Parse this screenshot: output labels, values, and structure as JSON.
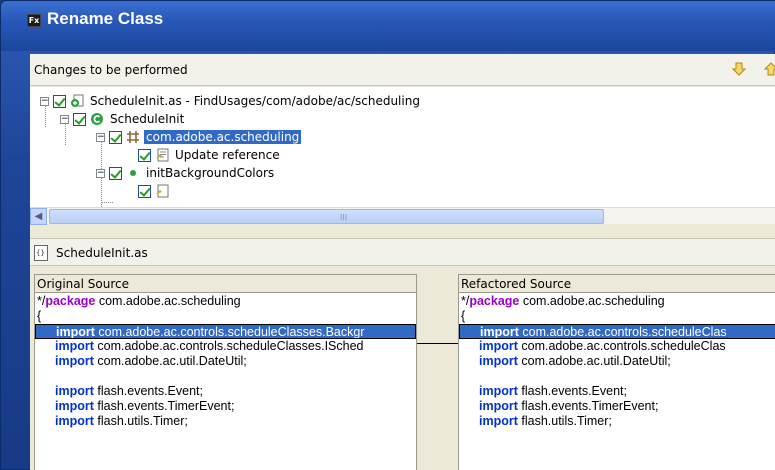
{
  "window": {
    "icon_text": "Fx",
    "title": "Rename Class"
  },
  "changes_panel": {
    "label": "Changes to be performed"
  },
  "tree": {
    "nodes": [
      {
        "label": "ScheduleInit.as - FindUsages/com/adobe/ac/scheduling"
      },
      {
        "label": "ScheduleInit"
      },
      {
        "label": "com.adobe.ac.scheduling"
      },
      {
        "label": "Update reference"
      },
      {
        "label": "initBackgroundColors"
      }
    ]
  },
  "scrollbar": {
    "grip": "III"
  },
  "file_panel": {
    "label": "ScheduleInit.as"
  },
  "original": {
    "title": "Original Source",
    "lines": [
      {
        "pre": "*/",
        "kw": "package",
        "rest": " com.adobe.ac.scheduling"
      },
      {
        "text": "{"
      },
      {
        "imp": "import",
        "rest": " com.adobe.ac.controls.scheduleClasses.Backgr"
      },
      {
        "imp": "import",
        "rest": " com.adobe.ac.controls.scheduleClasses.ISched"
      },
      {
        "imp": "import",
        "rest": " com.adobe.ac.util.DateUtil;"
      },
      {
        "text": ""
      },
      {
        "imp": "import",
        "rest": " flash.events.Event;"
      },
      {
        "imp": "import",
        "rest": " flash.events.TimerEvent;"
      },
      {
        "imp": "import",
        "rest": " flash.utils.Timer;"
      }
    ]
  },
  "refactored": {
    "title": "Refactored Source",
    "lines": [
      {
        "pre": "*/",
        "kw": "package",
        "rest": " com.adobe.ac.scheduling"
      },
      {
        "text": "{"
      },
      {
        "imp": "import",
        "rest": " com.adobe.ac.controls.scheduleClas"
      },
      {
        "imp": "import",
        "rest": " com.adobe.ac.controls.scheduleClas"
      },
      {
        "imp": "import",
        "rest": " com.adobe.ac.util.DateUtil;"
      },
      {
        "text": ""
      },
      {
        "imp": "import",
        "rest": " flash.events.Event;"
      },
      {
        "imp": "import",
        "rest": " flash.events.TimerEvent;"
      },
      {
        "imp": "import",
        "rest": " flash.utils.Timer;"
      }
    ]
  }
}
